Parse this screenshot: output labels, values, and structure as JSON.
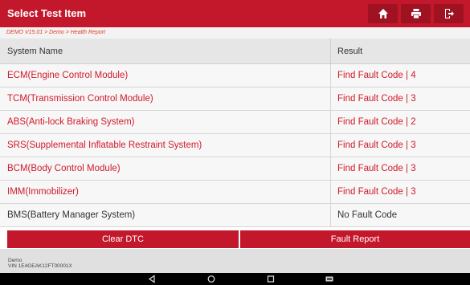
{
  "header": {
    "title": "Select Test Item",
    "buttons": [
      {
        "icon": "home-icon"
      },
      {
        "icon": "printer-icon"
      },
      {
        "icon": "exit-icon"
      }
    ]
  },
  "breadcrumb": "DEMO V15.01 > Demo > Health Report",
  "table": {
    "columns": [
      "System Name",
      "Result"
    ],
    "rows": [
      {
        "system": "ECM(Engine Control Module)",
        "result": "Find Fault Code | 4",
        "status": "fault"
      },
      {
        "system": "TCM(Transmission Control Module)",
        "result": "Find Fault Code | 3",
        "status": "fault"
      },
      {
        "system": "ABS(Anti-lock Braking System)",
        "result": "Find Fault Code | 2",
        "status": "fault"
      },
      {
        "system": "SRS(Supplemental Inflatable Restraint System)",
        "result": "Find Fault Code | 3",
        "status": "fault"
      },
      {
        "system": "BCM(Body Control Module)",
        "result": "Find Fault Code | 3",
        "status": "fault"
      },
      {
        "system": "IMM(Immobilizer)",
        "result": "Find Fault Code | 3",
        "status": "fault"
      },
      {
        "system": "BMS(Battery Manager System)",
        "result": "No Fault Code",
        "status": "ok"
      }
    ]
  },
  "actions": {
    "clear_dtc": "Clear DTC",
    "fault_report": "Fault Report"
  },
  "footer": {
    "line1": "Demo",
    "line2": "VIN 1E4GEAK12FT00001X"
  },
  "colors": {
    "accent": "#c3182c",
    "fault_text": "#d01a2a"
  },
  "navbar": [
    "back-icon",
    "home-circle-icon",
    "recents-icon",
    "keyboard-icon"
  ]
}
